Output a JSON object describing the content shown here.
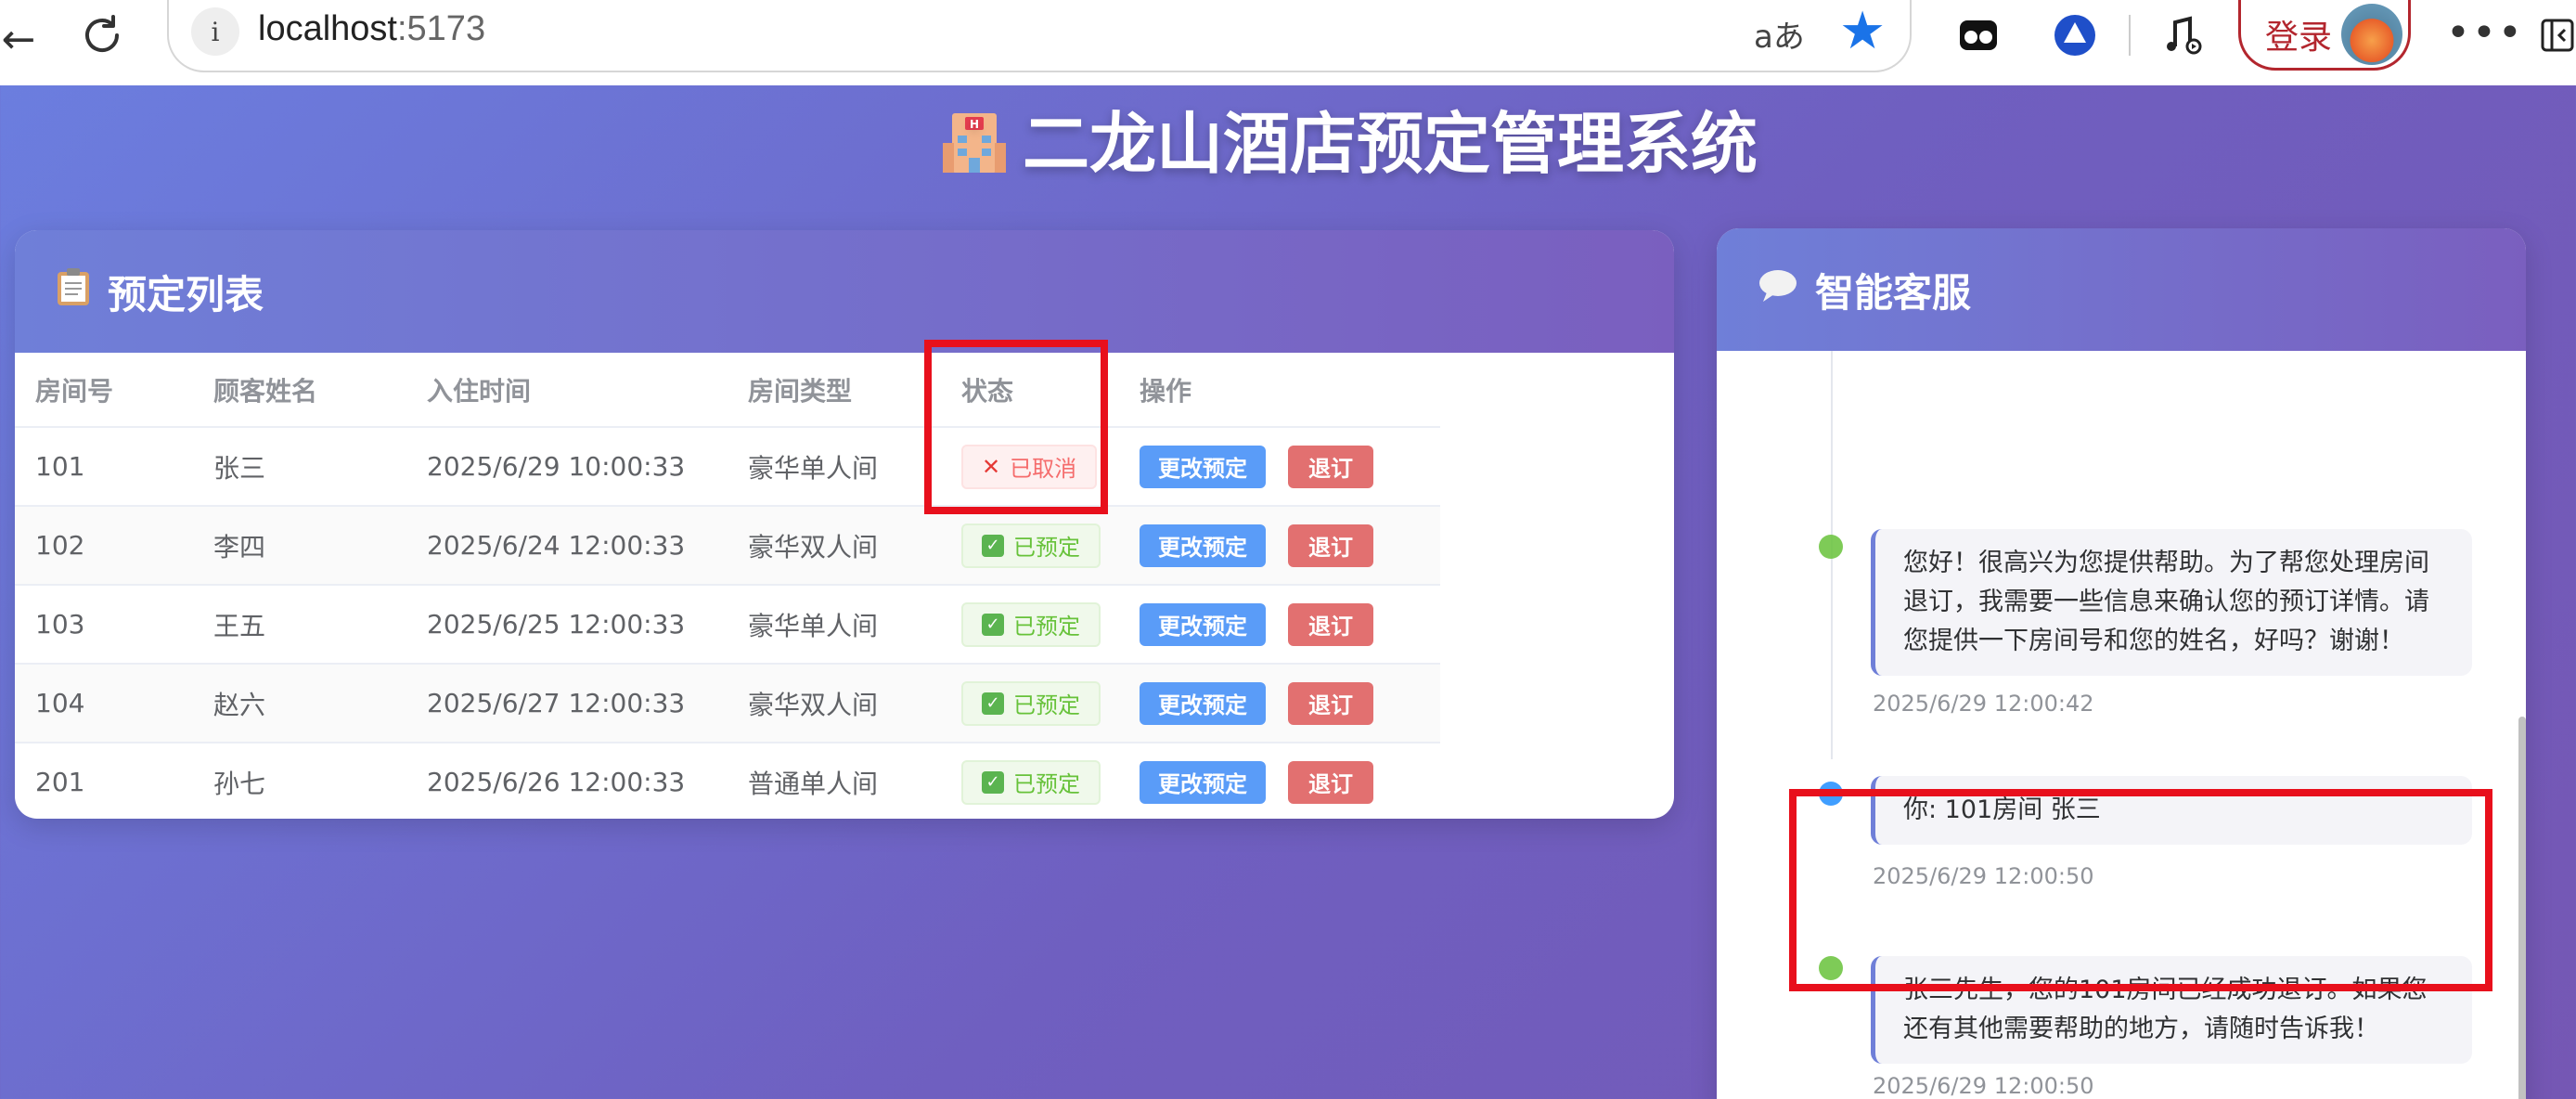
{
  "browser": {
    "url_host": "localhost",
    "url_port": ":5173",
    "read_aloud_label": "aあ",
    "login_label": "登录",
    "icons": [
      "back-icon",
      "reload-icon",
      "info-icon",
      "read-aloud-icon",
      "favorite-star-icon",
      "extension-icon",
      "copilot-icon",
      "media-icon",
      "avatar",
      "more-icon",
      "sidebar-icon"
    ]
  },
  "page": {
    "title": "二龙山酒店预定管理系统",
    "title_icon": "hotel-icon"
  },
  "booking": {
    "header": "预定列表",
    "header_icon": "clipboard-icon",
    "columns": [
      "房间号",
      "顾客姓名",
      "入住时间",
      "房间类型",
      "状态",
      "操作"
    ],
    "edit_label": "更改预定",
    "checkout_label": "退订",
    "rows": [
      {
        "room": "101",
        "name": "张三",
        "time": "2025/6/29 10:00:33",
        "type": "豪华单人间",
        "status": "已取消",
        "status_kind": "cancelled"
      },
      {
        "room": "102",
        "name": "李四",
        "time": "2025/6/24 12:00:33",
        "type": "豪华双人间",
        "status": "已预定",
        "status_kind": "booked"
      },
      {
        "room": "103",
        "name": "王五",
        "time": "2025/6/25 12:00:33",
        "type": "豪华单人间",
        "status": "已预定",
        "status_kind": "booked"
      },
      {
        "room": "104",
        "name": "赵六",
        "time": "2025/6/27 12:00:33",
        "type": "豪华双人间",
        "status": "已预定",
        "status_kind": "booked"
      },
      {
        "room": "201",
        "name": "孙七",
        "time": "2025/6/26 12:00:33",
        "type": "普通单人间",
        "status": "已预定",
        "status_kind": "booked"
      }
    ]
  },
  "chat": {
    "header": "智能客服",
    "header_icon": "speech-bubble-icon",
    "messages": [
      {
        "role": "assistant",
        "text": "您好！很高兴为您提供帮助。为了帮您处理房间退订，我需要一些信息来确认您的预订详情。请您提供一下房间号和您的姓名，好吗？谢谢！",
        "time": "2025/6/29 12:00:42"
      },
      {
        "role": "user",
        "text": "你: 101房间 张三",
        "time": "2025/6/29 12:00:50"
      },
      {
        "role": "assistant",
        "text": "张三先生，您的101房间已经成功退订。如果您还有其他需要帮助的地方，请随时告诉我！",
        "time": "2025/6/29 12:00:50"
      }
    ]
  },
  "colors": {
    "background_gradient_start": "#6b7fe0",
    "background_gradient_end": "#7557b4",
    "edit_button": "#5a9cf8",
    "checkout_button": "#e27070",
    "cancelled_text": "#f56c6c",
    "booked_text": "#67c23a",
    "annotation_red": "#e8101c"
  }
}
